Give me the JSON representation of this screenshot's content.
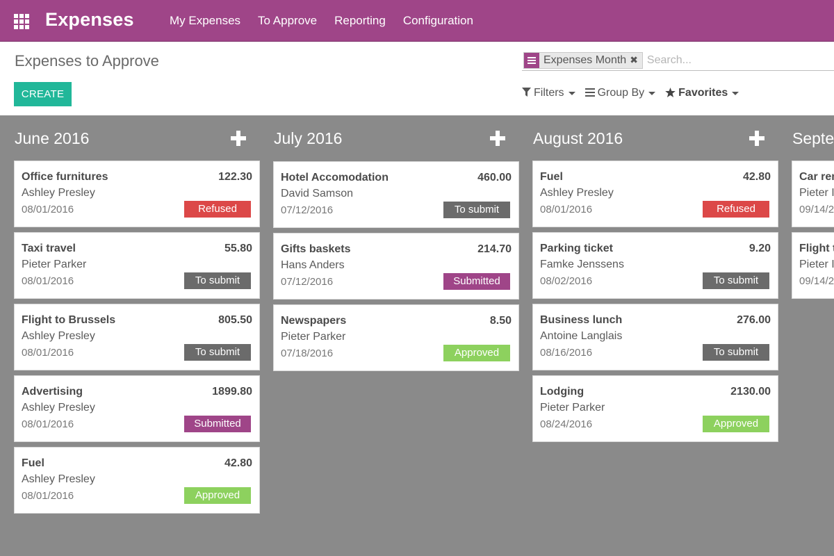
{
  "app": {
    "brand": "Expenses",
    "menu": [
      "My Expenses",
      "To Approve",
      "Reporting",
      "Configuration"
    ]
  },
  "control_panel": {
    "title": "Expenses to Approve",
    "create_label": "CREATE",
    "facet_label": "Expenses Month",
    "facet_remove": "✖",
    "search_placeholder": "Search...",
    "filters_label": "Filters",
    "group_by_label": "Group By",
    "favorites_label": "Favorites"
  },
  "columns": [
    {
      "title": "June 2016",
      "cards": [
        {
          "name": "Office furnitures",
          "amount": "122.30",
          "employee": "Ashley Presley",
          "date": "08/01/2016",
          "state": "Refused",
          "state_key": "refused"
        },
        {
          "name": "Taxi travel",
          "amount": "55.80",
          "employee": "Pieter Parker",
          "date": "08/01/2016",
          "state": "To submit",
          "state_key": "to_submit"
        },
        {
          "name": "Flight to Brussels",
          "amount": "805.50",
          "employee": "Ashley Presley",
          "date": "08/01/2016",
          "state": "To submit",
          "state_key": "to_submit"
        },
        {
          "name": "Advertising",
          "amount": "1899.80",
          "employee": "Ashley Presley",
          "date": "08/01/2016",
          "state": "Submitted",
          "state_key": "submitted"
        },
        {
          "name": "Fuel",
          "amount": "42.80",
          "employee": "Ashley Presley",
          "date": "08/01/2016",
          "state": "Approved",
          "state_key": "approved"
        }
      ]
    },
    {
      "title": "July 2016",
      "cards": [
        {
          "name": "Hotel Accomodation",
          "amount": "460.00",
          "employee": "David Samson",
          "date": "07/12/2016",
          "state": "To submit",
          "state_key": "to_submit"
        },
        {
          "name": "Gifts baskets",
          "amount": "214.70",
          "employee": "Hans Anders",
          "date": "07/12/2016",
          "state": "Submitted",
          "state_key": "submitted"
        },
        {
          "name": "Newspapers",
          "amount": "8.50",
          "employee": "Pieter Parker",
          "date": "07/18/2016",
          "state": "Approved",
          "state_key": "approved"
        }
      ]
    },
    {
      "title": "August 2016",
      "cards": [
        {
          "name": "Fuel",
          "amount": "42.80",
          "employee": "Ashley Presley",
          "date": "08/01/2016",
          "state": "Refused",
          "state_key": "refused"
        },
        {
          "name": "Parking ticket",
          "amount": "9.20",
          "employee": "Famke Jenssens",
          "date": "08/02/2016",
          "state": "To submit",
          "state_key": "to_submit"
        },
        {
          "name": "Business lunch",
          "amount": "276.00",
          "employee": "Antoine Langlais",
          "date": "08/16/2016",
          "state": "To submit",
          "state_key": "to_submit"
        },
        {
          "name": "Lodging",
          "amount": "2130.00",
          "employee": "Pieter Parker",
          "date": "08/24/2016",
          "state": "Approved",
          "state_key": "approved"
        }
      ]
    },
    {
      "title": "Septe",
      "cards": [
        {
          "name": "Car ren",
          "amount": "",
          "employee": "Pieter I",
          "date": "09/14/2",
          "state": "",
          "state_key": ""
        },
        {
          "name": "Flight t",
          "amount": "",
          "employee": "Pieter I",
          "date": "09/14/2",
          "state": "",
          "state_key": ""
        }
      ]
    }
  ],
  "colors": {
    "brand": "#9f4588",
    "create": "#21b799",
    "refused": "#dc4848",
    "to_submit": "#6b6b6b",
    "submitted": "#9f4588",
    "approved": "#8dd15e",
    "kanban_bg": "#8a8a8a"
  },
  "icons": {
    "apps": "apps-grid-icon",
    "facet": "group-by-icon",
    "filters": "filter-icon",
    "group_by": "list-icon",
    "favorites": "star-icon",
    "quick_create": "plus-icon"
  }
}
